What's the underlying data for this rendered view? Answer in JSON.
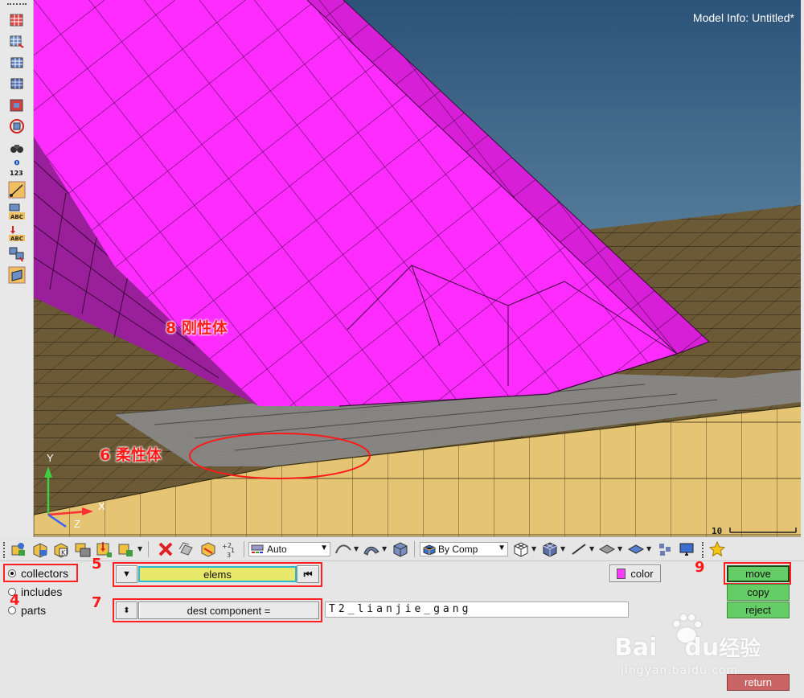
{
  "viewport": {
    "model_info": "Model Info: Untitled*",
    "annotation_rigid": "8 刚性体",
    "annotation_flexible": "6 柔性体",
    "triad": {
      "y": "Y",
      "x": "X",
      "z": "Z"
    },
    "scale_label": "10",
    "colors": {
      "sky_top": "#2e557a",
      "sky_bottom": "#577e9c",
      "rigid": "#ff2cff",
      "flexible_top": "#e8c977",
      "ground": "#6b5a35",
      "gray_elems": "#8a8a8a",
      "annotation": "#ff1a1a"
    }
  },
  "left_toolbar": {
    "icons": [
      "panel-icon",
      "panel-icon",
      "panel-icon",
      "panel-icon",
      "panel-icon",
      "panel-icon",
      "binoculars-icon",
      "info-icon",
      "panel-icon",
      "panel-icon",
      "panel-icon",
      "panel-icon",
      "panel-icon"
    ],
    "numbers_label": "123"
  },
  "bottom_toolbar": {
    "display_mode": "Auto",
    "color_mode": "By Comp"
  },
  "panel": {
    "radio_options": [
      {
        "label": "collectors",
        "selected": true
      },
      {
        "label": "includes",
        "selected": false
      },
      {
        "label": "parts",
        "selected": false
      }
    ],
    "entity_selector": "elems",
    "dest_label": "dest component =",
    "dest_value": "T2_lianjie_gang",
    "color_button": "color",
    "color_swatch": "#ff3cff",
    "actions": {
      "move": "move",
      "copy": "copy",
      "reject": "reject",
      "return": "return"
    },
    "step_numbers": {
      "collectors": "4",
      "entity": "5",
      "dest": "7",
      "move": "9"
    }
  },
  "watermark": {
    "brand": "Bai",
    "brand_suffix": "du",
    "cn": "经验",
    "url": "jingyan.baidu.com"
  }
}
